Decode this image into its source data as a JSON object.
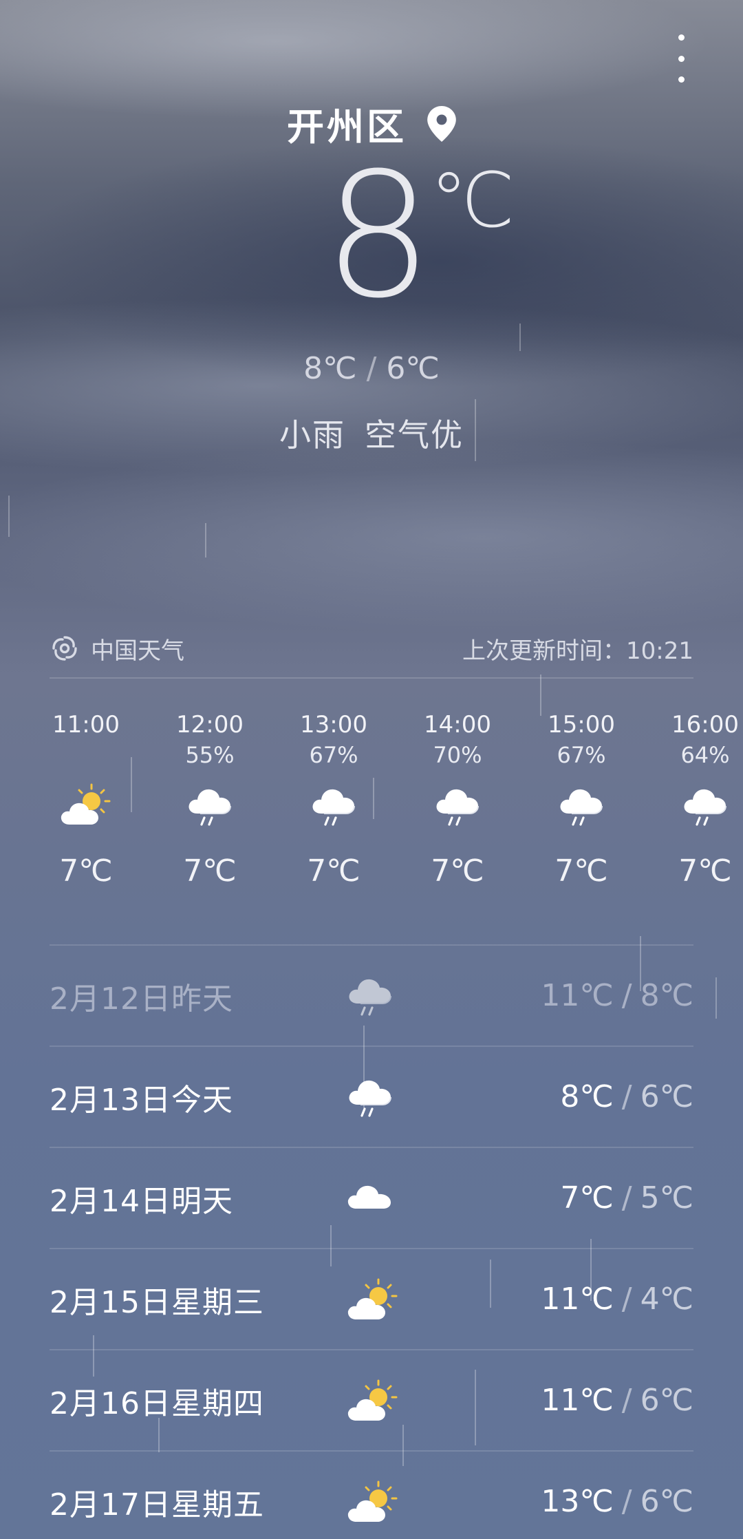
{
  "header": {
    "city": "开州区",
    "location_icon": "location-pin-icon",
    "menu_icon": "more-vert-icon"
  },
  "current": {
    "temp": "8",
    "unit": "℃",
    "high": "8℃",
    "separator": "/",
    "low": "6℃",
    "weather": "小雨",
    "air_quality": "空气优"
  },
  "source": {
    "logo_icon": "china-weather-logo-icon",
    "name": "中国天气",
    "update_label": "上次更新时间：10:21"
  },
  "hourly": [
    {
      "time": "11:00",
      "precip": "",
      "icon": "partly-sunny-icon",
      "temp": "7℃"
    },
    {
      "time": "12:00",
      "precip": "55%",
      "icon": "light-rain-icon",
      "temp": "7℃"
    },
    {
      "time": "13:00",
      "precip": "67%",
      "icon": "light-rain-icon",
      "temp": "7℃"
    },
    {
      "time": "14:00",
      "precip": "70%",
      "icon": "light-rain-icon",
      "temp": "7℃"
    },
    {
      "time": "15:00",
      "precip": "67%",
      "icon": "light-rain-icon",
      "temp": "7℃"
    },
    {
      "time": "16:00",
      "precip": "64%",
      "icon": "light-rain-icon",
      "temp": "7℃"
    }
  ],
  "daily": [
    {
      "date": "2月12日昨天",
      "icon": "light-rain-icon",
      "high": "11℃",
      "sep": "/",
      "low": "8℃",
      "past": true
    },
    {
      "date": "2月13日今天",
      "icon": "light-rain-icon",
      "high": "8℃",
      "sep": "/",
      "low": "6℃",
      "past": false
    },
    {
      "date": "2月14日明天",
      "icon": "cloudy-icon",
      "high": "7℃",
      "sep": "/",
      "low": "5℃",
      "past": false
    },
    {
      "date": "2月15日星期三",
      "icon": "partly-sunny-icon",
      "high": "11℃",
      "sep": "/",
      "low": "4℃",
      "past": false
    },
    {
      "date": "2月16日星期四",
      "icon": "partly-sunny-icon",
      "high": "11℃",
      "sep": "/",
      "low": "6℃",
      "past": false
    },
    {
      "date": "2月17日星期五",
      "icon": "partly-sunny-icon",
      "high": "13℃",
      "sep": "/",
      "low": "6℃",
      "past": false
    }
  ]
}
